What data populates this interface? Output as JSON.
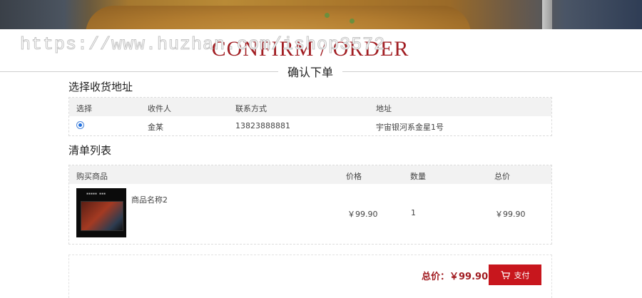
{
  "watermark": "https://www.huzhan.com/ishop3572",
  "title": {
    "en": "CONFIRM / ORDER",
    "cn": "确认下单"
  },
  "address_section": {
    "title": "选择收货地址",
    "headers": [
      "选择",
      "收件人",
      "联系方式",
      "地址"
    ],
    "rows": [
      {
        "selected": true,
        "recipient": "金某",
        "phone": "13823888881",
        "address": "宇宙银河系金星1号"
      }
    ]
  },
  "order_section": {
    "title": "清单列表",
    "headers": [
      "购买商品",
      "价格",
      "数量",
      "总价"
    ],
    "items": [
      {
        "name": "商品名称2",
        "price": "￥99.90",
        "qty": "1",
        "subtotal": "￥99.90"
      }
    ]
  },
  "summary": {
    "total_label": "总价：",
    "total_value": "￥99.90",
    "pay_label": "支付",
    "pay_icon": "cart-icon"
  },
  "colors": {
    "accent": "#a11d22",
    "button": "#c8161d",
    "radio": "#1f6fe0"
  }
}
